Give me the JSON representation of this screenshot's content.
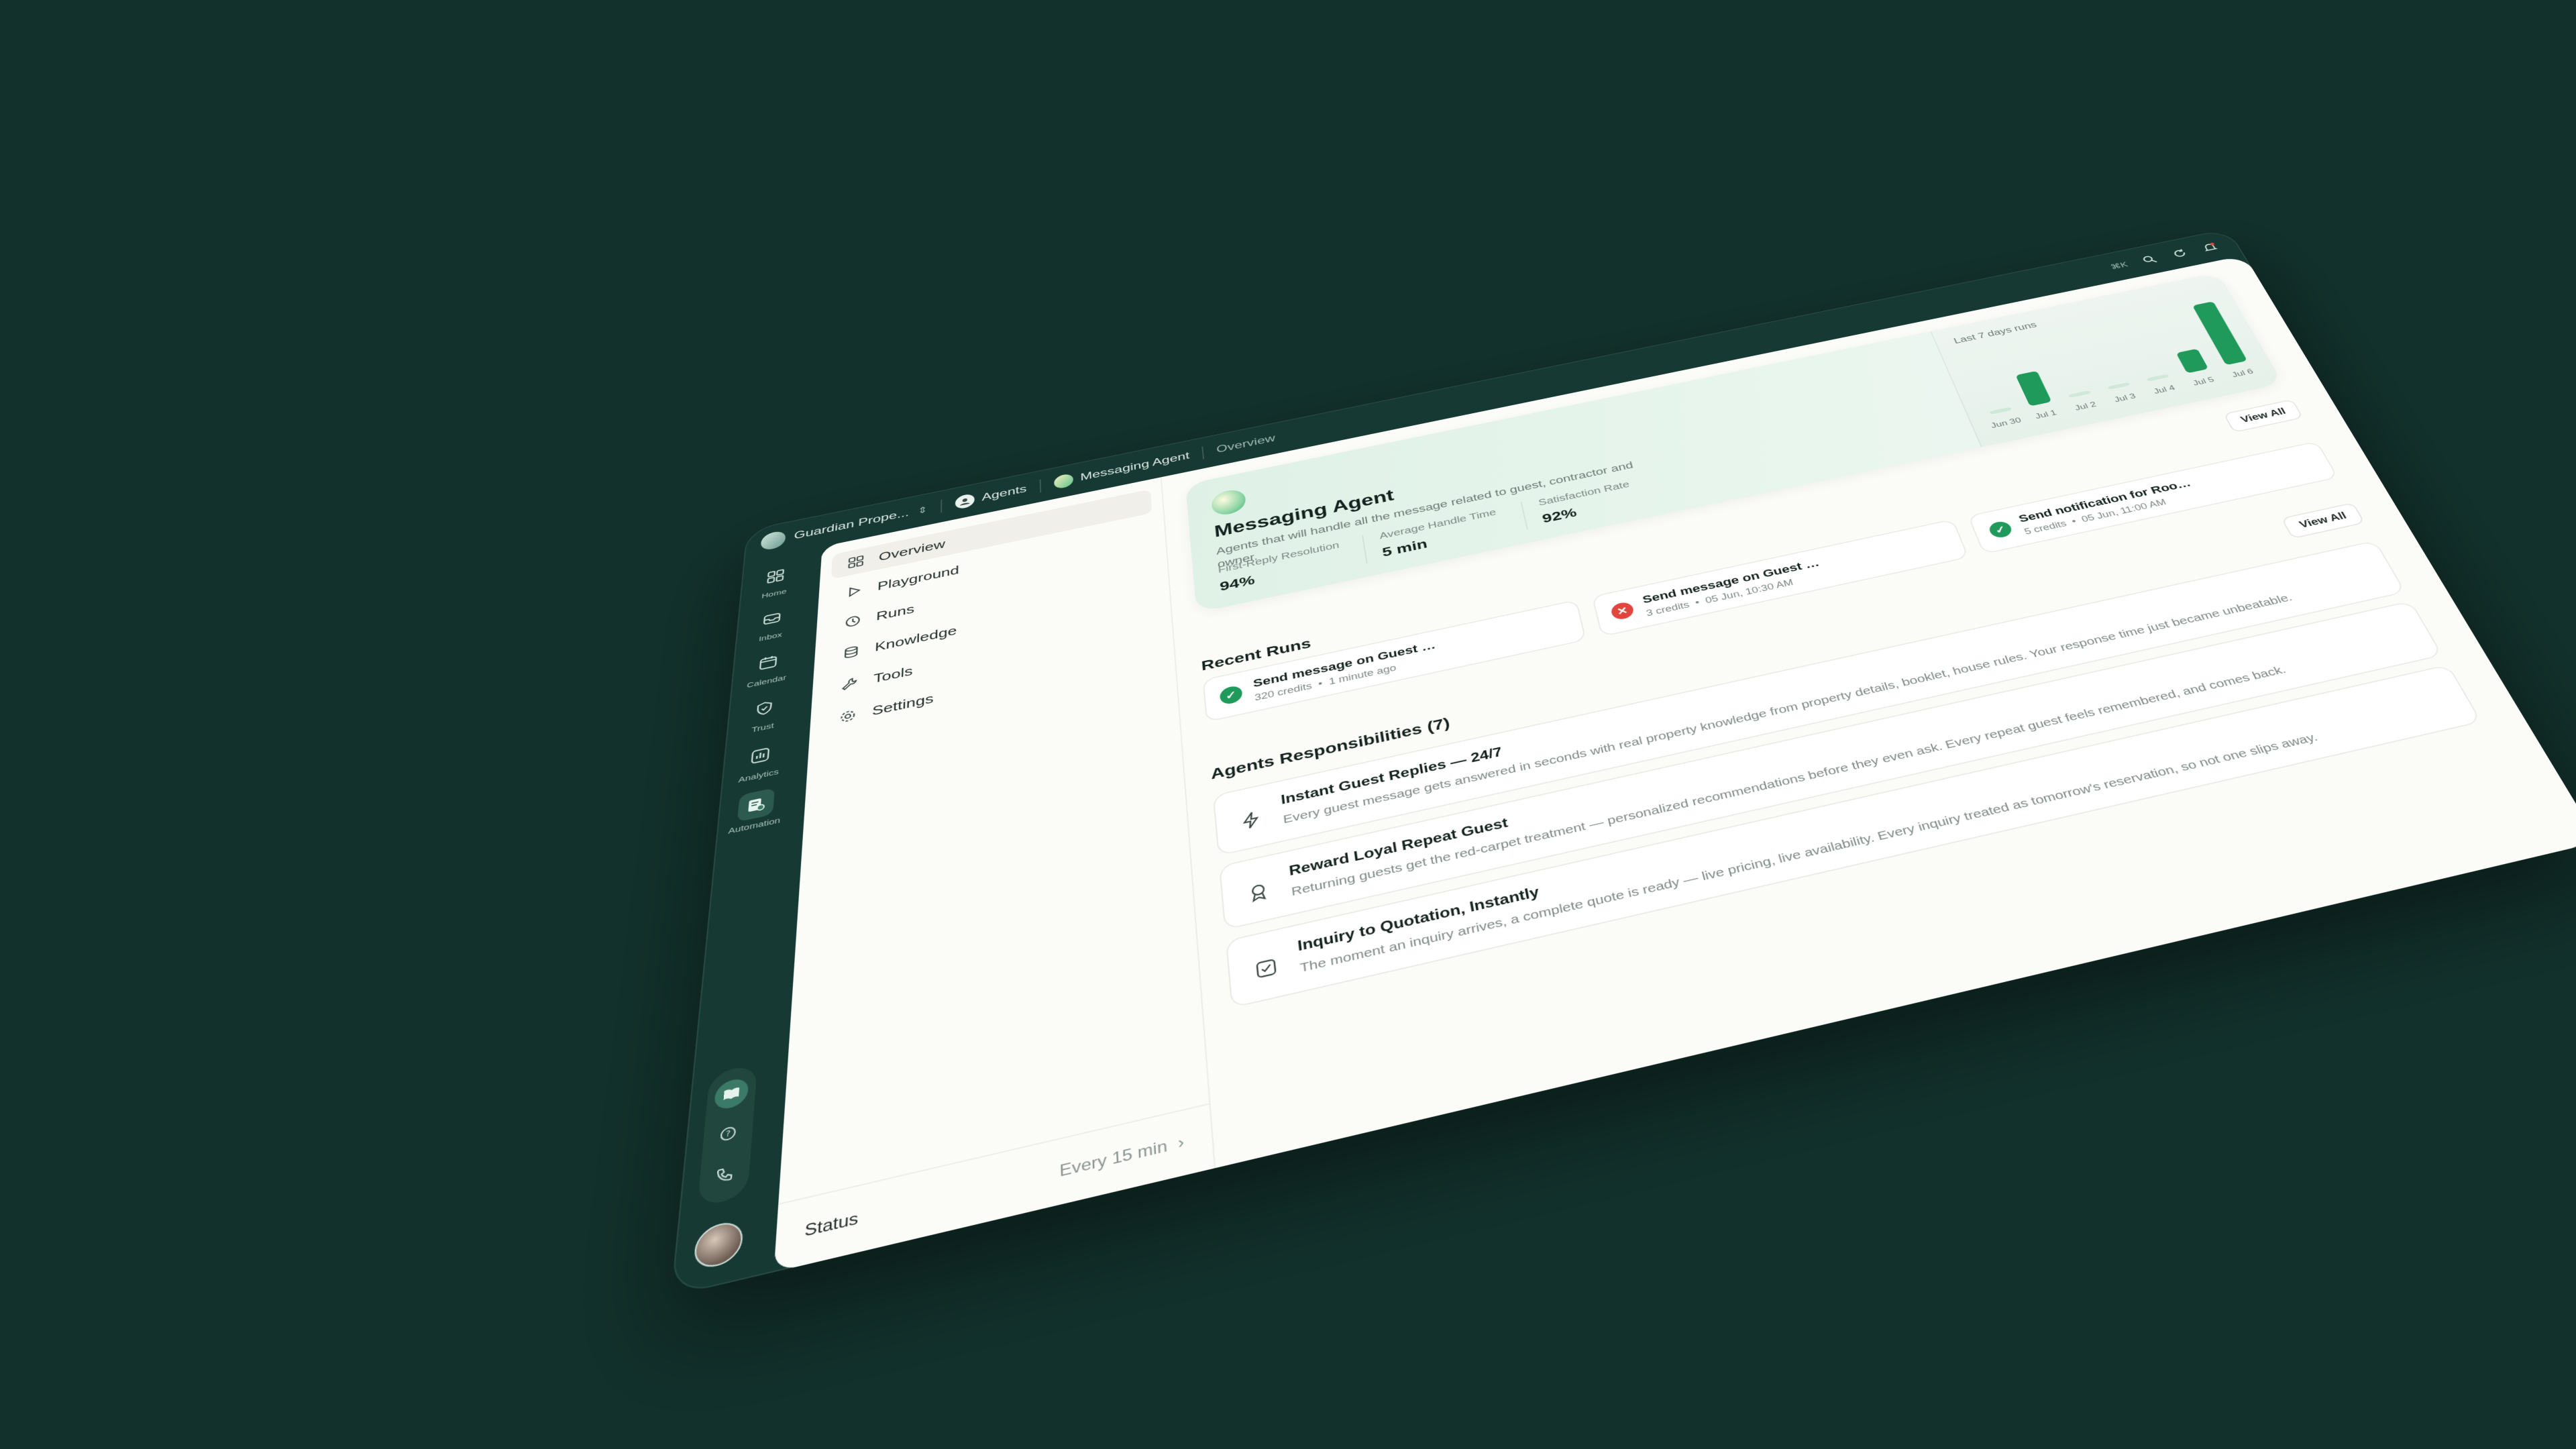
{
  "topbar": {
    "workspace": "Guardian Prope...",
    "crumbs": [
      "Agents",
      "Messaging Agent",
      "Overview"
    ],
    "shortcut": "⌘K"
  },
  "rail": {
    "items": [
      {
        "label": "Home",
        "icon": "home-icon"
      },
      {
        "label": "Inbox",
        "icon": "inbox-icon"
      },
      {
        "label": "Calendar",
        "icon": "calendar-icon"
      },
      {
        "label": "Trust",
        "icon": "shield-icon"
      },
      {
        "label": "Analytics",
        "icon": "chart-icon"
      },
      {
        "label": "Automation",
        "icon": "automation-icon"
      }
    ]
  },
  "subnav": {
    "items": [
      "Overview",
      "Playground",
      "Runs",
      "Knowledge",
      "Tools",
      "Settings"
    ],
    "active": "Overview",
    "status_label": "Status",
    "status_value": "Every 15 min"
  },
  "hero": {
    "title": "Messaging Agent",
    "description": "Agents that will handle all the message related to guest, contractor and owner.",
    "metrics": [
      {
        "label": "First-Reply Resolution",
        "value": "94%"
      },
      {
        "label": "Average Handle Time",
        "value": "5 min"
      },
      {
        "label": "Satisfaction Rate",
        "value": "92%"
      }
    ]
  },
  "chart_data": {
    "type": "bar",
    "title": "Last 7 days runs",
    "categories": [
      "Jun 30",
      "Jul 1",
      "Jul 2",
      "Jul 3",
      "Jul 4",
      "Jul 5",
      "Jul 6"
    ],
    "values": [
      0,
      6,
      0,
      0,
      0,
      4,
      12
    ],
    "colors": {
      "bar": "#1f9a5a",
      "empty": "#cfe8d8"
    }
  },
  "recent_runs": {
    "title": "Recent Runs",
    "view_all": "View All",
    "items": [
      {
        "title": "Send message on Guest Ch...",
        "credits": "320 credits",
        "time": "1 minute ago",
        "status": "success"
      },
      {
        "title": "Send message on Guest Ch...",
        "credits": "3 credits",
        "time": "05 Jun, 10:30 AM",
        "status": "failed"
      },
      {
        "title": "Send notification for Room...",
        "credits": "5 credits",
        "time": "05 Jun, 11:00 AM",
        "status": "success"
      }
    ]
  },
  "responsibilities": {
    "title": "Agents Responsibilities",
    "count": "(7)",
    "view_all": "View All",
    "items": [
      {
        "title": "Instant Guest Replies — 24/7",
        "desc": "Every guest message gets answered in seconds with real property knowledge from property details, booklet, house rules. Your response time just became unbeatable.",
        "icon": "lightning-icon"
      },
      {
        "title": "Reward Loyal Repeat Guest",
        "desc": "Returning guests get the red-carpet treatment — personalized recommendations before they even ask. Every repeat guest feels remembered, and comes back.",
        "icon": "award-icon"
      },
      {
        "title": "Inquiry to Quotation, Instantly",
        "desc": "The moment an inquiry arrives, a complete quote is ready — live pricing, live availability. Every inquiry treated as tomorrow's reservation, so not one slips away.",
        "icon": "checkbox-icon"
      }
    ]
  }
}
